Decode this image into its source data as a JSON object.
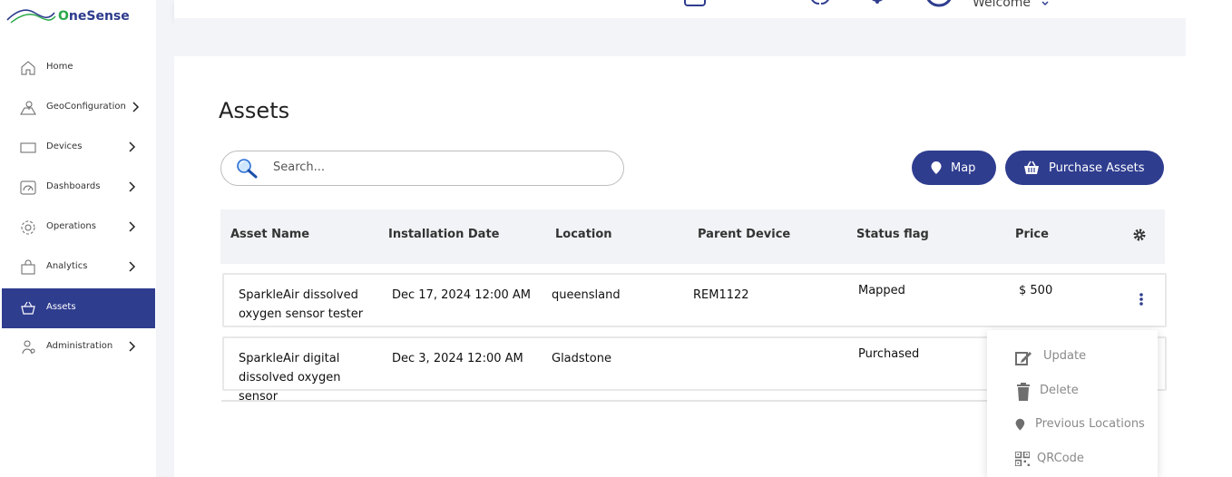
{
  "app": {
    "logo_text_prefix": "O",
    "logo_text": "neSense"
  },
  "sidebar": {
    "items": [
      {
        "label": "Home",
        "icon": "home-icon"
      },
      {
        "label": "GeoConfiguration",
        "icon": "map-icon"
      },
      {
        "label": "Devices",
        "icon": "monitor-icon"
      },
      {
        "label": "Dashboards",
        "icon": "gauge-icon"
      },
      {
        "label": "Operations",
        "icon": "gear-icon"
      },
      {
        "label": "Analytics",
        "icon": "bag-icon"
      },
      {
        "label": "Assets",
        "icon": "basket-icon",
        "active": true
      },
      {
        "label": "Administration",
        "icon": "user-gear-icon"
      }
    ]
  },
  "header": {
    "welcome": "Welcome"
  },
  "main": {
    "title": "Assets",
    "search": {
      "placeholder": "Search..."
    },
    "map_button": "Map",
    "purchase_button": "Purchase Assets",
    "columns": [
      "Asset Name",
      "Installation Date",
      "Location",
      "Parent Device",
      "Status flag",
      "Price"
    ],
    "rows": [
      {
        "asset_name_line1": "SparkleAir dissolved",
        "asset_name_line2": "oxygen sensor tester",
        "asset_name_line3": "",
        "installation_date": "Dec 17, 2024 12:00 AM",
        "location": "queensland",
        "parent_device": "REM1122",
        "status": "Mapped",
        "price": "$ 500"
      },
      {
        "asset_name_line1": "SparkleAir digital",
        "asset_name_line2": "dissolved oxygen",
        "asset_name_line3": "sensor",
        "installation_date": "Dec 3, 2024 12:00 AM",
        "location": "Gladstone",
        "parent_device": "",
        "status": "Purchased",
        "price": ""
      }
    ]
  },
  "context_menu": {
    "update": "Update",
    "delete": "Delete",
    "previous_locations": "Previous Locations",
    "qrcode": "QRCode"
  },
  "colors": {
    "primary": "#2f3d8f",
    "accent_green": "#2aa84a"
  }
}
